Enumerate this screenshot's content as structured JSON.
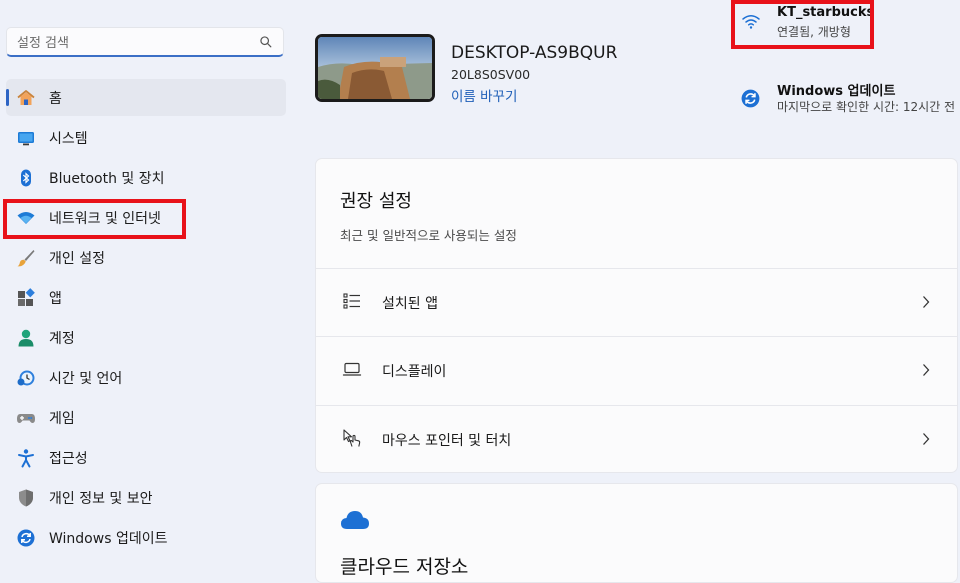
{
  "search": {
    "placeholder": "설정 검색"
  },
  "nav": {
    "items": [
      {
        "label": "홈",
        "icon": "home-icon"
      },
      {
        "label": "시스템",
        "icon": "system-icon"
      },
      {
        "label": "Bluetooth 및 장치",
        "icon": "bluetooth-icon"
      },
      {
        "label": "네트워크 및 인터넷",
        "icon": "wifi-icon"
      },
      {
        "label": "개인 설정",
        "icon": "brush-icon"
      },
      {
        "label": "앱",
        "icon": "apps-icon"
      },
      {
        "label": "계정",
        "icon": "account-icon"
      },
      {
        "label": "시간 및 언어",
        "icon": "clock-globe-icon"
      },
      {
        "label": "게임",
        "icon": "gamepad-icon"
      },
      {
        "label": "접근성",
        "icon": "accessibility-icon"
      },
      {
        "label": "개인 정보 및 보안",
        "icon": "shield-icon"
      },
      {
        "label": "Windows 업데이트",
        "icon": "update-icon"
      }
    ]
  },
  "device": {
    "name": "DESKTOP-AS9BQUR",
    "model": "20L8S0SV00",
    "rename_label": "이름 바꾸기"
  },
  "network": {
    "name": "KT_starbucks",
    "status": "연결됨, 개방형"
  },
  "update": {
    "title": "Windows 업데이트",
    "status": "마지막으로 확인한 시간: 12시간 전"
  },
  "recommended": {
    "title": "권장 설정",
    "subtitle": "최근 및 일반적으로 사용되는 설정",
    "rows": [
      {
        "label": "설치된 앱",
        "icon": "list-icon"
      },
      {
        "label": "디스플레이",
        "icon": "laptop-icon"
      },
      {
        "label": "마우스 포인터 및 터치",
        "icon": "pointer-touch-icon"
      }
    ]
  },
  "cloud": {
    "title": "클라우드 저장소"
  },
  "colors": {
    "accent": "#2d64c4",
    "highlight": "#e8121a",
    "link": "#1f5fb8"
  }
}
